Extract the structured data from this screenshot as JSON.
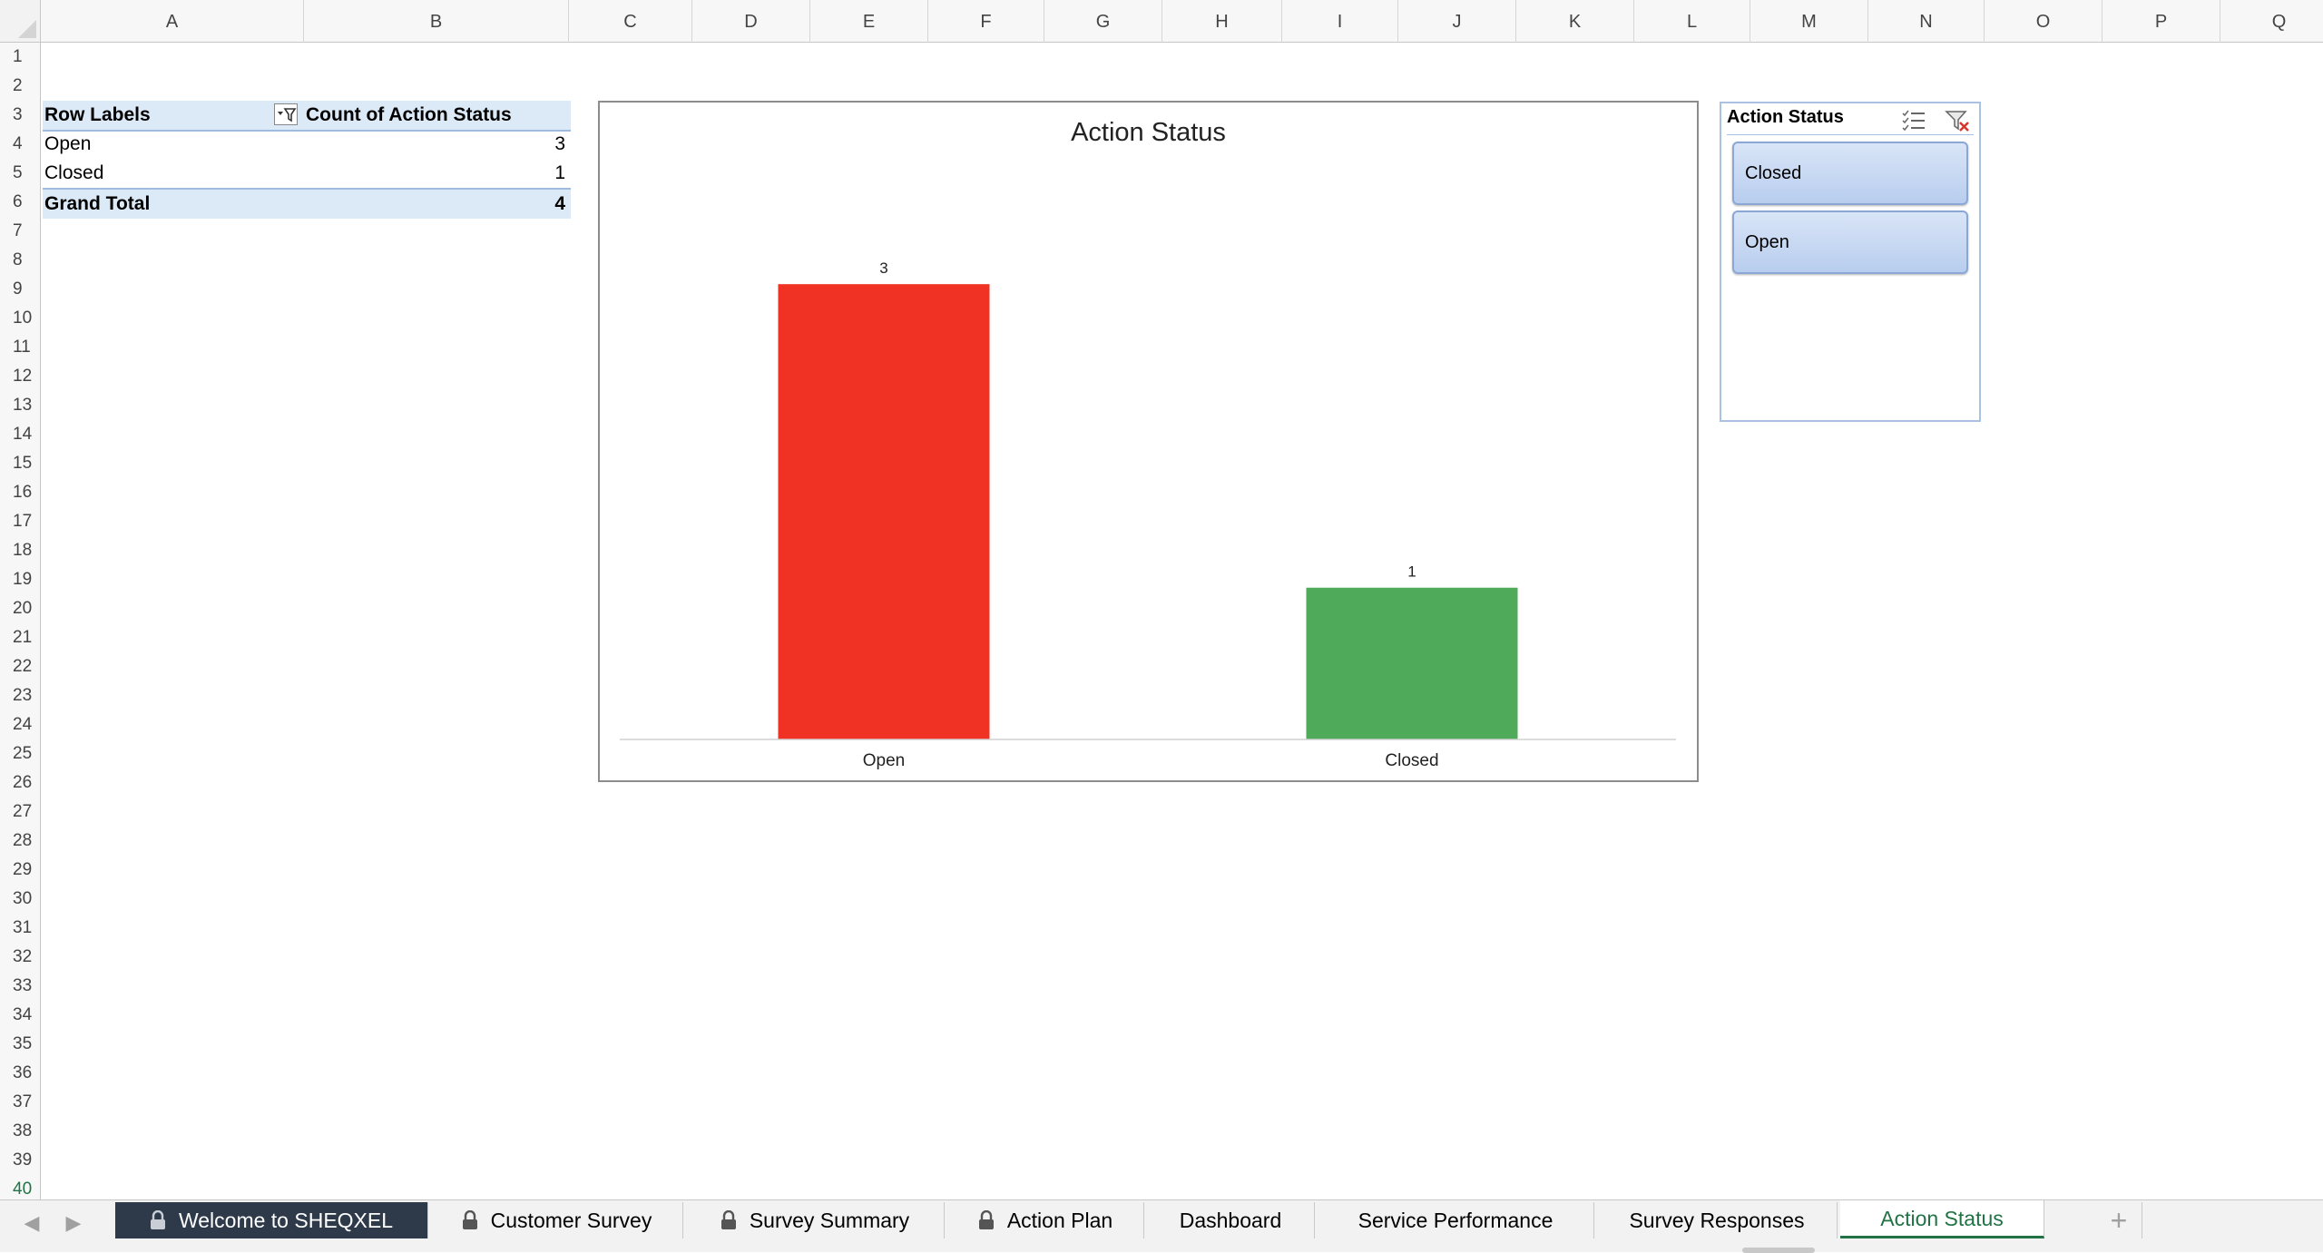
{
  "columns": [
    "A",
    "B",
    "C",
    "D",
    "E",
    "F",
    "G",
    "H",
    "I",
    "J",
    "K",
    "L",
    "M",
    "N",
    "O",
    "P",
    "Q"
  ],
  "rows": [
    "1",
    "2",
    "3",
    "4",
    "5",
    "6",
    "7",
    "8",
    "9",
    "10",
    "11",
    "12",
    "13",
    "14",
    "15",
    "16",
    "17",
    "18",
    "19",
    "20",
    "21",
    "22",
    "23",
    "24",
    "25",
    "26",
    "27",
    "28",
    "29",
    "30",
    "31",
    "32",
    "33",
    "34",
    "35",
    "36",
    "37",
    "38",
    "39",
    "40"
  ],
  "pivot": {
    "header_row_labels": "Row Labels",
    "header_count": "Count of Action Status",
    "rows": [
      {
        "label": "Open",
        "value": "3"
      },
      {
        "label": "Closed",
        "value": "1"
      }
    ],
    "total_label": "Grand Total",
    "total_value": "4"
  },
  "chart_data": {
    "type": "bar",
    "title": "Action Status",
    "categories": [
      "Open",
      "Closed"
    ],
    "values": [
      3,
      1
    ],
    "data_labels": [
      "3",
      "1"
    ],
    "colors": [
      "#ef3223",
      "#4fab5a"
    ],
    "ylim": [
      0,
      3.3
    ],
    "grid": false,
    "legend": "none"
  },
  "slicer": {
    "title": "Action Status",
    "items": [
      "Closed",
      "Open"
    ],
    "accent": "#a9c1e2"
  },
  "tabs": [
    {
      "label": "Welcome to SHEQXEL",
      "locked": true,
      "style": "dark"
    },
    {
      "label": "Customer Survey",
      "locked": true,
      "style": "normal"
    },
    {
      "label": "Survey Summary",
      "locked": true,
      "style": "normal"
    },
    {
      "label": "Action Plan",
      "locked": true,
      "style": "normal"
    },
    {
      "label": "Dashboard",
      "locked": false,
      "style": "normal"
    },
    {
      "label": "Service Performance",
      "locked": false,
      "style": "normal"
    },
    {
      "label": "Survey Responses",
      "locked": false,
      "style": "normal"
    },
    {
      "label": "Action Status",
      "locked": false,
      "style": "active"
    }
  ],
  "tab_add_label": "+",
  "active_color": "#217346"
}
